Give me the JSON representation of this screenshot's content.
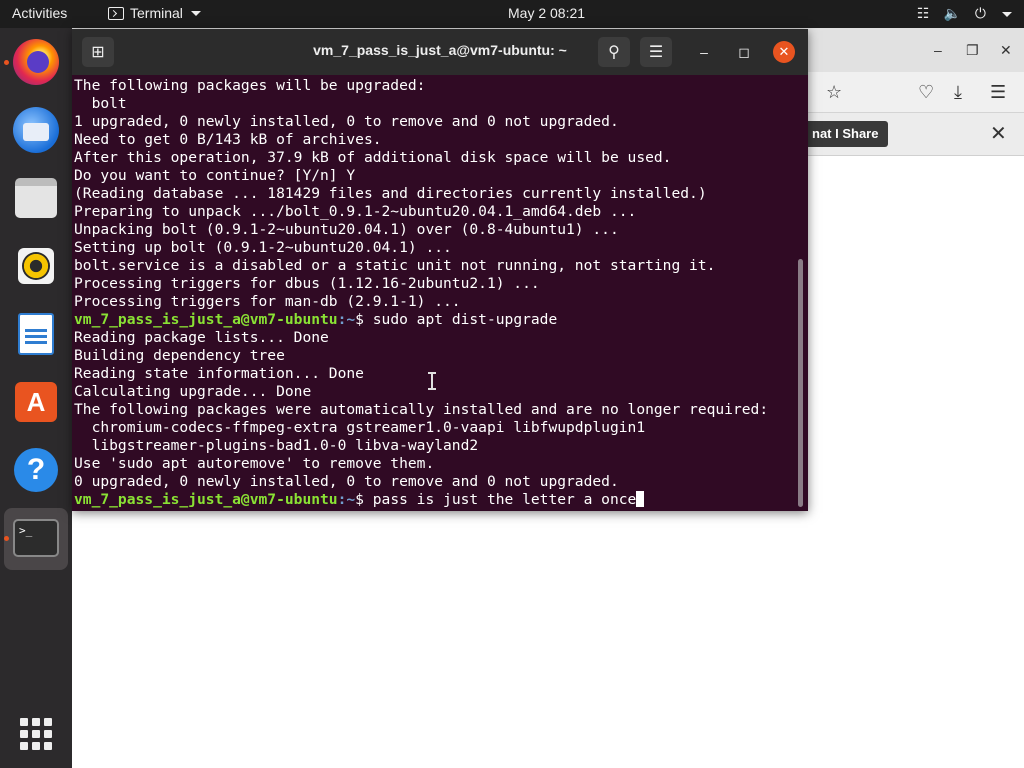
{
  "topbar": {
    "activities": "Activities",
    "app_name": "Terminal",
    "clock": "May 2  08:21"
  },
  "dock": {
    "items": [
      "firefox",
      "thunderbird",
      "files",
      "rhythmbox",
      "libreoffice-writer",
      "ubuntu-software",
      "help",
      "terminal",
      "show-applications"
    ]
  },
  "browser": {
    "notification_text": "nat I Share"
  },
  "terminal": {
    "title": "vm_7_pass_is_just_a@vm7-ubuntu: ~",
    "prompt_user": "vm_7_pass_is_just_a@vm7-ubuntu",
    "prompt_path": ":~",
    "lines": [
      {
        "kind": "out",
        "text": "The following packages will be upgraded:"
      },
      {
        "kind": "out",
        "text": "  bolt"
      },
      {
        "kind": "out",
        "text": "1 upgraded, 0 newly installed, 0 to remove and 0 not upgraded."
      },
      {
        "kind": "out",
        "text": "Need to get 0 B/143 kB of archives."
      },
      {
        "kind": "out",
        "text": "After this operation, 37.9 kB of additional disk space will be used."
      },
      {
        "kind": "out",
        "text": "Do you want to continue? [Y/n] Y"
      },
      {
        "kind": "out",
        "text": "(Reading database ... 181429 files and directories currently installed.)"
      },
      {
        "kind": "out",
        "text": "Preparing to unpack .../bolt_0.9.1-2~ubuntu20.04.1_amd64.deb ..."
      },
      {
        "kind": "out",
        "text": "Unpacking bolt (0.9.1-2~ubuntu20.04.1) over (0.8-4ubuntu1) ..."
      },
      {
        "kind": "out",
        "text": "Setting up bolt (0.9.1-2~ubuntu20.04.1) ..."
      },
      {
        "kind": "out",
        "text": "bolt.service is a disabled or a static unit not running, not starting it."
      },
      {
        "kind": "out",
        "text": "Processing triggers for dbus (1.12.16-2ubuntu2.1) ..."
      },
      {
        "kind": "out",
        "text": "Processing triggers for man-db (2.9.1-1) ..."
      },
      {
        "kind": "prompt",
        "text": "$ sudo apt dist-upgrade"
      },
      {
        "kind": "out",
        "text": "Reading package lists... Done"
      },
      {
        "kind": "out",
        "text": "Building dependency tree"
      },
      {
        "kind": "out",
        "text": "Reading state information... Done"
      },
      {
        "kind": "out",
        "text": "Calculating upgrade... Done"
      },
      {
        "kind": "out",
        "text": "The following packages were automatically installed and are no longer required:"
      },
      {
        "kind": "out",
        "text": "  chromium-codecs-ffmpeg-extra gstreamer1.0-vaapi libfwupdplugin1"
      },
      {
        "kind": "out",
        "text": "  libgstreamer-plugins-bad1.0-0 libva-wayland2"
      },
      {
        "kind": "out",
        "text": "Use 'sudo apt autoremove' to remove them."
      },
      {
        "kind": "out",
        "text": "0 upgraded, 0 newly installed, 0 to remove and 0 not upgraded."
      },
      {
        "kind": "prompt",
        "text": "$ pass is just the letter a once",
        "cursor": true
      }
    ]
  },
  "colors": {
    "terminal_bg": "#300a24",
    "prompt_user": "#8ae234",
    "prompt_path": "#729fcf",
    "accent": "#e95420"
  }
}
